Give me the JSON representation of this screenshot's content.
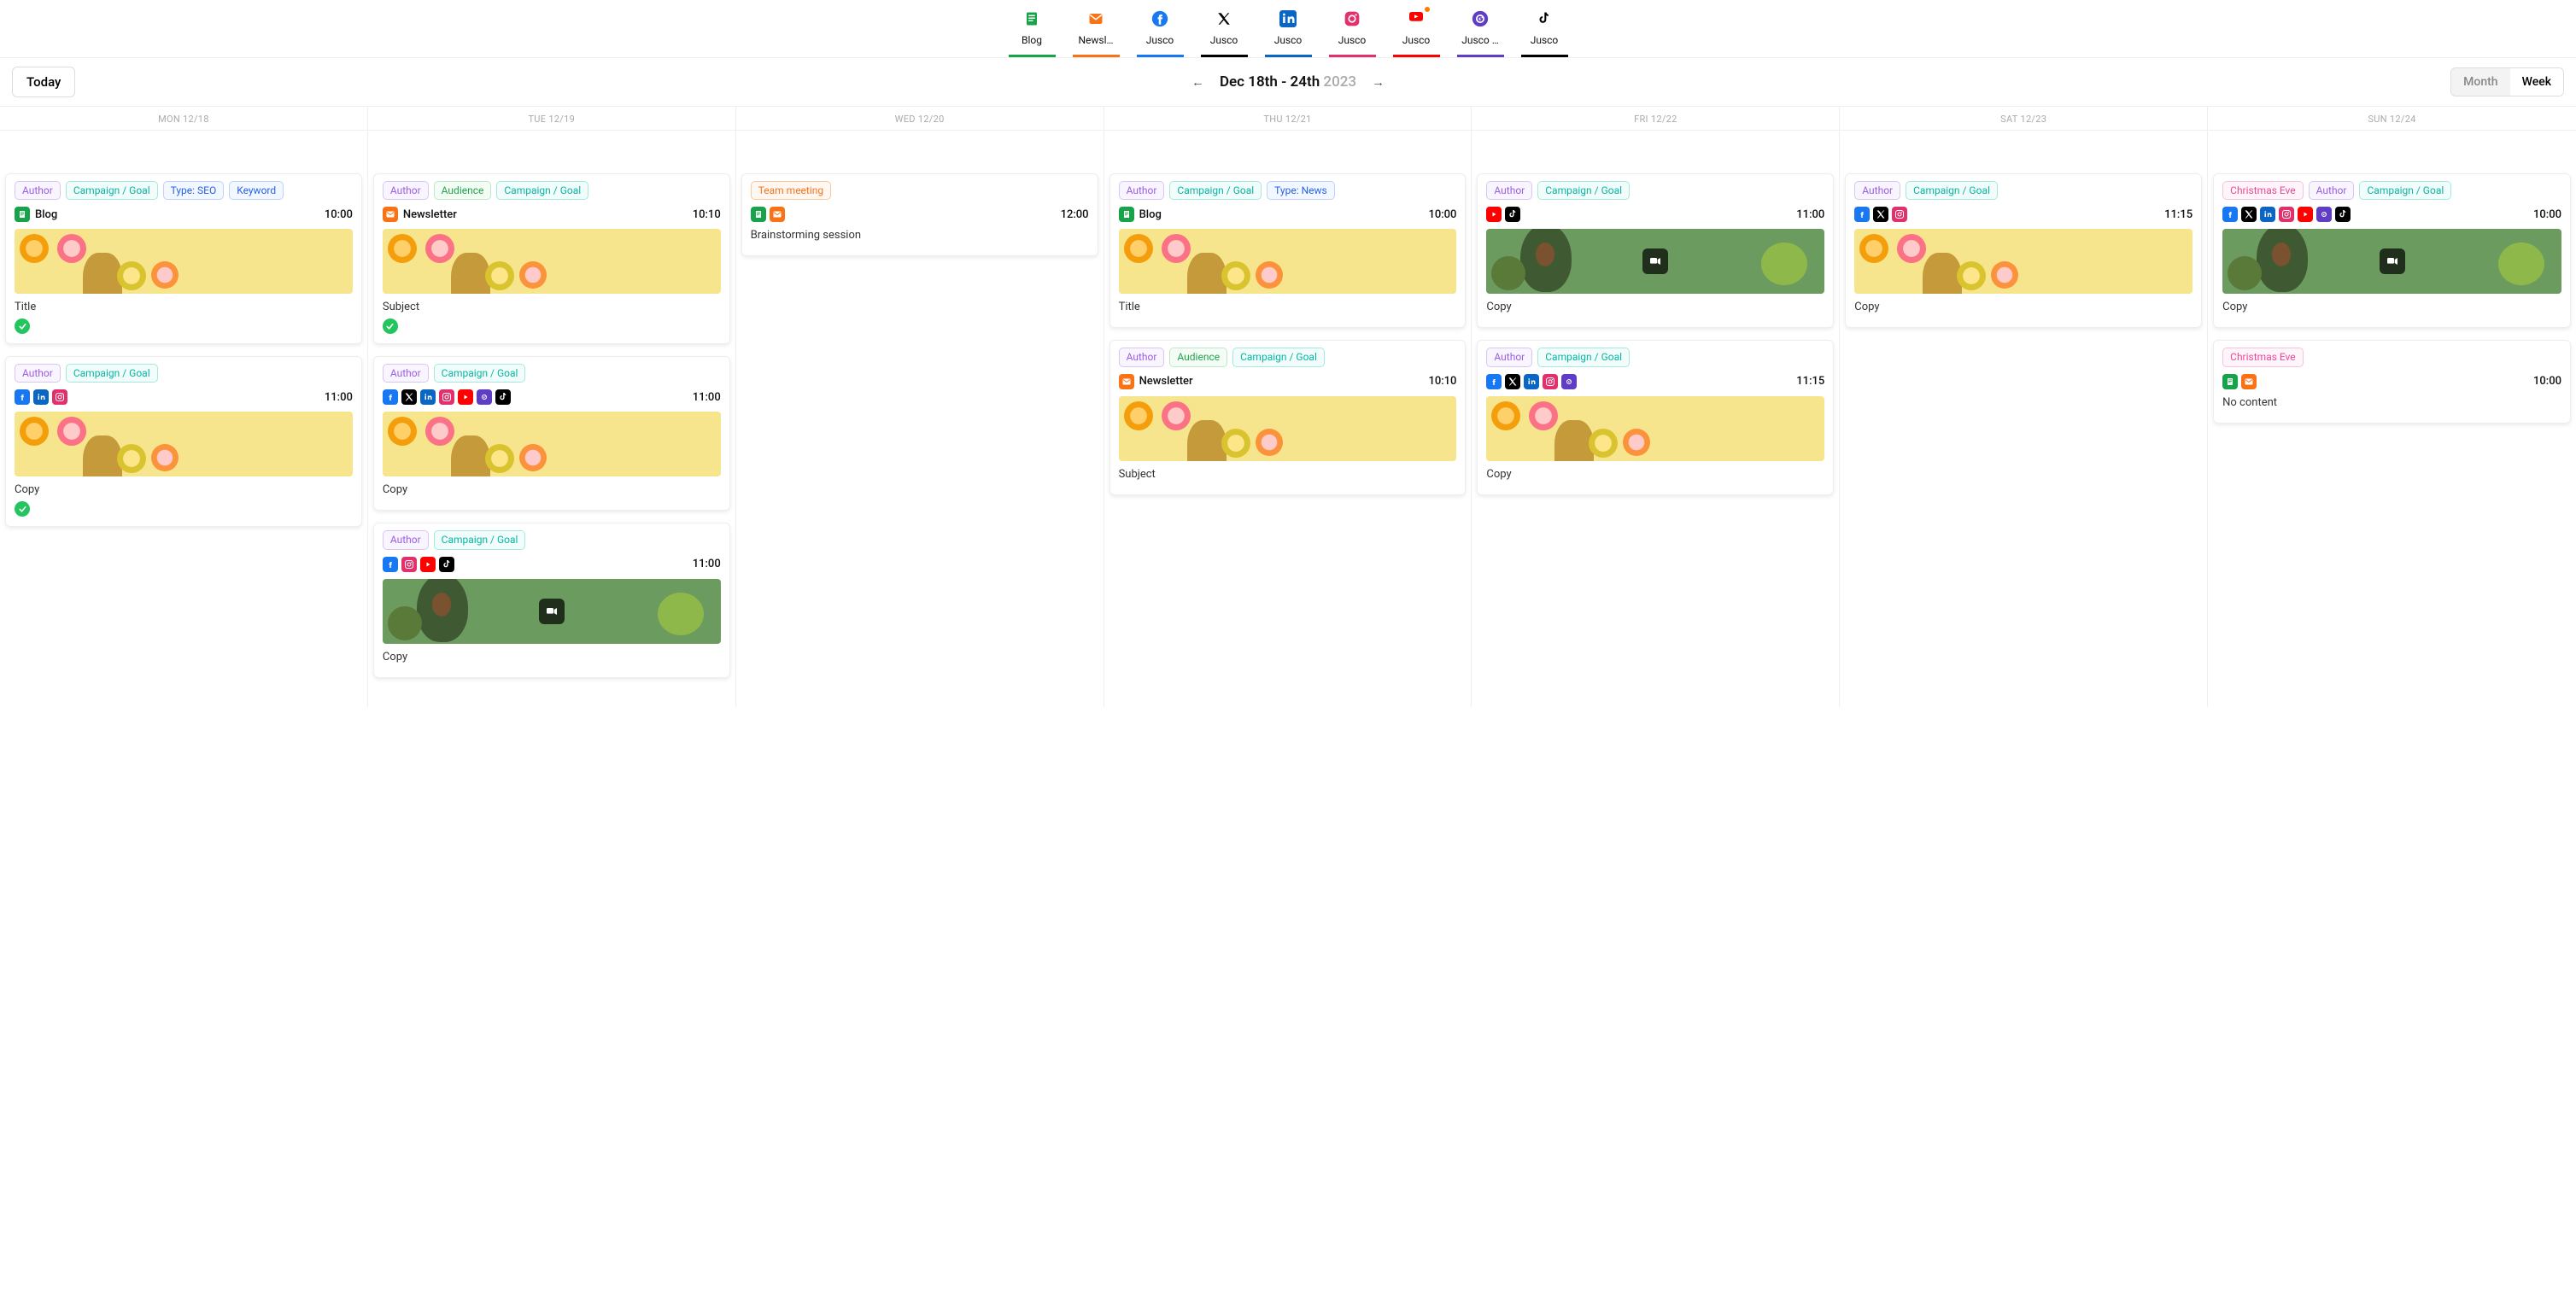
{
  "channels": [
    {
      "label": "Blog",
      "color": "#16a34a",
      "icon": "blog"
    },
    {
      "label": "Newsl…",
      "color": "#f97316",
      "icon": "newsletter"
    },
    {
      "label": "Jusco",
      "color": "#1877f2",
      "icon": "facebook"
    },
    {
      "label": "Jusco",
      "color": "#000000",
      "icon": "x"
    },
    {
      "label": "Jusco",
      "color": "#0a66c2",
      "icon": "linkedin"
    },
    {
      "label": "Jusco",
      "color": "#e1306c",
      "icon": "instagram"
    },
    {
      "label": "Jusco",
      "color": "#ff0000",
      "icon": "youtube",
      "dot": true
    },
    {
      "label": "Jusco …",
      "color": "#5f3dc4",
      "icon": "gmb"
    },
    {
      "label": "Jusco",
      "color": "#000000",
      "icon": "tiktok"
    }
  ],
  "toolbar": {
    "today_label": "Today",
    "range": "Dec 18th - 24th",
    "year": "2023",
    "month_label": "Month",
    "week_label": "Week"
  },
  "days": [
    {
      "header": "MON 12/18",
      "cards": [
        {
          "chips": [
            {
              "t": "Author",
              "k": "author"
            },
            {
              "t": "Campaign / Goal",
              "k": "campaign"
            },
            {
              "t": "Type: SEO",
              "k": "type"
            },
            {
              "t": "Keyword",
              "k": "keyword"
            }
          ],
          "ctype": "blog",
          "ctype_label": "Blog",
          "time": "10:00",
          "thumb": "fruit",
          "title": "Title",
          "check": true
        },
        {
          "chips": [
            {
              "t": "Author",
              "k": "author"
            },
            {
              "t": "Campaign / Goal",
              "k": "campaign"
            }
          ],
          "platforms": [
            "facebook",
            "linkedin",
            "instagram"
          ],
          "time": "11:00",
          "thumb": "fruit",
          "title": "Copy",
          "check": true
        }
      ]
    },
    {
      "header": "TUE 12/19",
      "cards": [
        {
          "chips": [
            {
              "t": "Author",
              "k": "author"
            },
            {
              "t": "Audience",
              "k": "audience"
            },
            {
              "t": "Campaign / Goal",
              "k": "campaign"
            }
          ],
          "ctype": "newsletter",
          "ctype_label": "Newsletter",
          "time": "10:10",
          "thumb": "fruit",
          "title": "Subject",
          "check": true
        },
        {
          "chips": [
            {
              "t": "Author",
              "k": "author"
            },
            {
              "t": "Campaign / Goal",
              "k": "campaign"
            }
          ],
          "platforms": [
            "facebook",
            "x",
            "linkedin",
            "instagram",
            "youtube",
            "gmb",
            "tiktok"
          ],
          "time": "11:00",
          "thumb": "fruit",
          "title": "Copy"
        },
        {
          "chips": [
            {
              "t": "Author",
              "k": "author"
            },
            {
              "t": "Campaign / Goal",
              "k": "campaign"
            }
          ],
          "platforms": [
            "facebook",
            "instagram",
            "youtube",
            "tiktok"
          ],
          "time": "11:00",
          "thumb": "video",
          "title": "Copy"
        }
      ]
    },
    {
      "header": "WED 12/20",
      "cards": [
        {
          "chips": [
            {
              "t": "Team meeting",
              "k": "meeting"
            }
          ],
          "platforms": [
            "blog",
            "newsletter"
          ],
          "time": "12:00",
          "title": "Brainstorming session"
        }
      ]
    },
    {
      "header": "THU 12/21",
      "cards": [
        {
          "chips": [
            {
              "t": "Author",
              "k": "author"
            },
            {
              "t": "Campaign / Goal",
              "k": "campaign"
            },
            {
              "t": "Type: News",
              "k": "type"
            }
          ],
          "ctype": "blog",
          "ctype_label": "Blog",
          "time": "10:00",
          "thumb": "fruit",
          "title": "Title"
        },
        {
          "chips": [
            {
              "t": "Author",
              "k": "author"
            },
            {
              "t": "Audience",
              "k": "audience"
            },
            {
              "t": "Campaign / Goal",
              "k": "campaign"
            }
          ],
          "ctype": "newsletter",
          "ctype_label": "Newsletter",
          "time": "10:10",
          "thumb": "fruit",
          "title": "Subject"
        }
      ]
    },
    {
      "header": "FRI 12/22",
      "cards": [
        {
          "chips": [
            {
              "t": "Author",
              "k": "author"
            },
            {
              "t": "Campaign / Goal",
              "k": "campaign"
            }
          ],
          "platforms": [
            "youtube",
            "tiktok"
          ],
          "time": "11:00",
          "thumb": "video",
          "title": "Copy"
        },
        {
          "chips": [
            {
              "t": "Author",
              "k": "author"
            },
            {
              "t": "Campaign / Goal",
              "k": "campaign"
            }
          ],
          "platforms": [
            "facebook",
            "x",
            "linkedin",
            "instagram",
            "gmb"
          ],
          "time": "11:15",
          "thumb": "fruit",
          "title": "Copy"
        }
      ]
    },
    {
      "header": "SAT 12/23",
      "cards": [
        {
          "chips": [
            {
              "t": "Author",
              "k": "author"
            },
            {
              "t": "Campaign / Goal",
              "k": "campaign"
            }
          ],
          "platforms": [
            "facebook",
            "x",
            "instagram"
          ],
          "time": "11:15",
          "thumb": "fruit",
          "title": "Copy"
        }
      ]
    },
    {
      "header": "SUN 12/24",
      "cards": [
        {
          "chips": [
            {
              "t": "Christmas Eve",
              "k": "event"
            },
            {
              "t": "Author",
              "k": "author"
            },
            {
              "t": "Campaign / Goal",
              "k": "campaign"
            }
          ],
          "platforms": [
            "facebook",
            "x",
            "linkedin",
            "instagram",
            "youtube",
            "gmb",
            "tiktok"
          ],
          "time": "10:00",
          "thumb": "video",
          "title": "Copy"
        },
        {
          "chips": [
            {
              "t": "Christmas Eve",
              "k": "event"
            }
          ],
          "platforms": [
            "blog",
            "newsletter"
          ],
          "time": "10:00",
          "title": "No content"
        }
      ]
    }
  ]
}
